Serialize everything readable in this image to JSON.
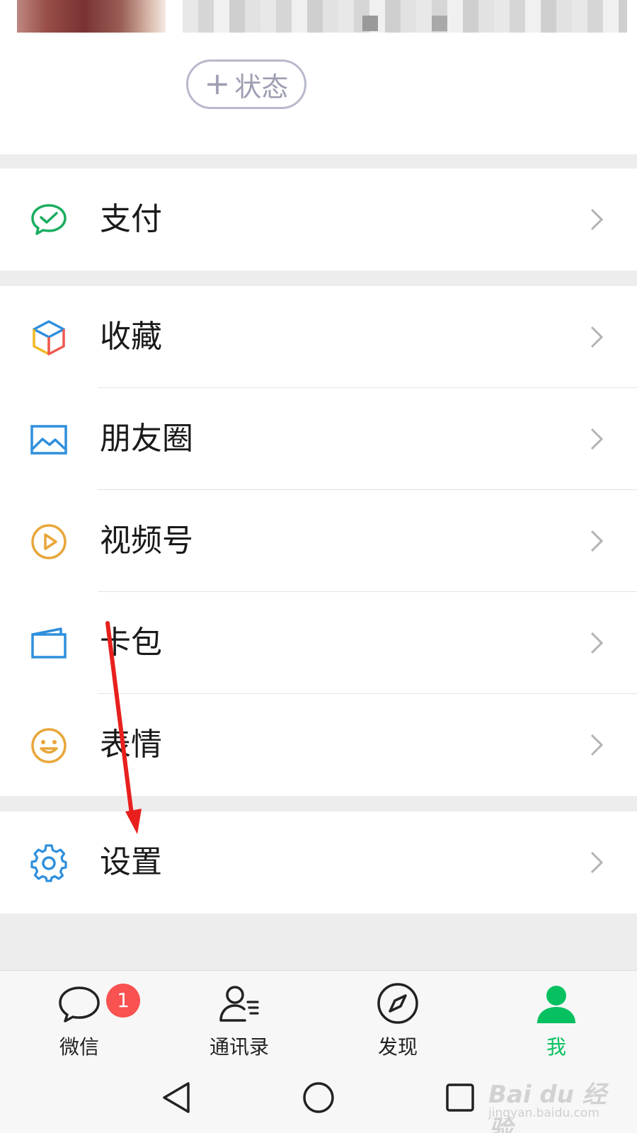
{
  "profile": {
    "status_plus": "+",
    "status_label": "状态"
  },
  "menu": {
    "pay": "支付",
    "favorites": "收藏",
    "moments": "朋友圈",
    "channels": "视频号",
    "cards": "卡包",
    "stickers": "表情",
    "settings": "设置"
  },
  "tabs": {
    "chats": "微信",
    "chats_badge": "1",
    "contacts": "通讯录",
    "discover": "发现",
    "me": "我"
  },
  "watermark": {
    "brand": "Bai du 经验",
    "url": "jingyan.baidu.com"
  },
  "colors": {
    "accent_green": "#07c160",
    "badge_red": "#fa5151",
    "annotation_arrow": "#e8201d"
  },
  "icons": {
    "pay": "pay-check-bubble-icon",
    "favorites": "cube-icon",
    "moments": "picture-icon",
    "channels": "play-circle-icon",
    "cards": "wallet-icon",
    "stickers": "smiley-icon",
    "settings": "gear-icon"
  }
}
